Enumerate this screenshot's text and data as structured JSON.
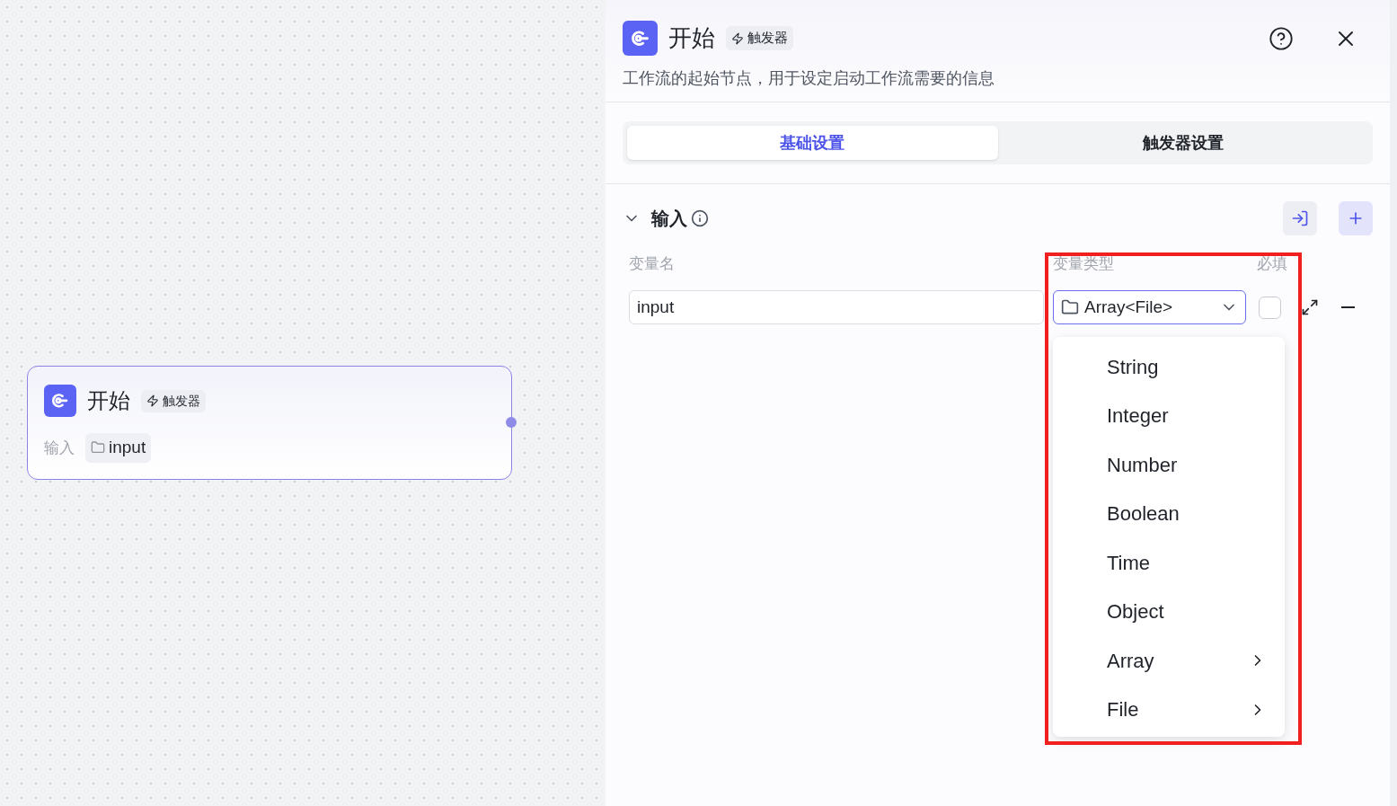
{
  "canvas": {
    "node": {
      "title": "开始",
      "badge": "触发器",
      "input_label": "输入",
      "input_chip": "input"
    }
  },
  "panel": {
    "title": "开始",
    "badge": "触发器",
    "description": "工作流的起始节点，用于设定启动工作流需要的信息",
    "tabs": [
      {
        "label": "基础设置",
        "selected": true
      },
      {
        "label": "触发器设置",
        "selected": false
      }
    ],
    "section": {
      "title": "输入",
      "expanded": true,
      "columns": [
        "变量名",
        "变量类型",
        "必填"
      ],
      "rows": [
        {
          "name": "input",
          "type": "Array<File>",
          "required": false
        }
      ]
    },
    "dropdown": {
      "options": [
        {
          "label": "String",
          "has_submenu": false
        },
        {
          "label": "Integer",
          "has_submenu": false
        },
        {
          "label": "Number",
          "has_submenu": false
        },
        {
          "label": "Boolean",
          "has_submenu": false
        },
        {
          "label": "Time",
          "has_submenu": false
        },
        {
          "label": "Object",
          "has_submenu": false
        },
        {
          "label": "Array",
          "has_submenu": true
        },
        {
          "label": "File",
          "has_submenu": true
        }
      ]
    }
  }
}
